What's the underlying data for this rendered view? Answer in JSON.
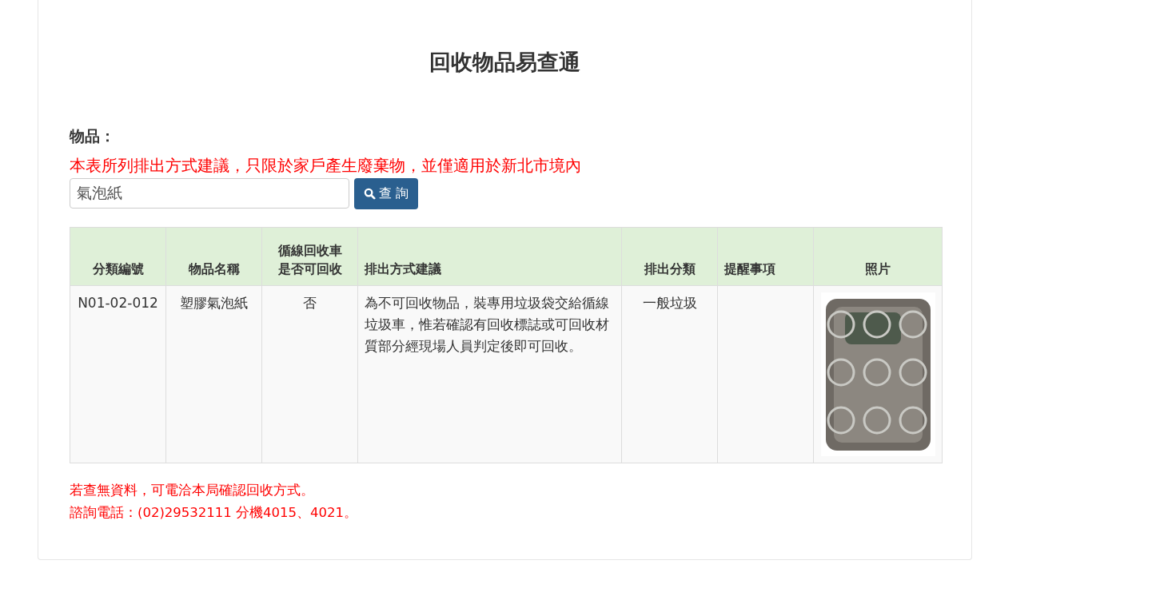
{
  "title": "回收物品易查通",
  "search": {
    "label": "物品：",
    "notice": "本表所列排出方式建議，只限於家戶產生廢棄物，並僅適用於新北市境內",
    "value": "氣泡紙",
    "button": "查 詢"
  },
  "table": {
    "columns": [
      {
        "label": "分類編號"
      },
      {
        "label": "物品名稱"
      },
      {
        "label": "循線回收車是否可回收"
      },
      {
        "label": "排出方式建議"
      },
      {
        "label": "排出分類"
      },
      {
        "label": "提醒事項"
      },
      {
        "label": "照片"
      }
    ],
    "rows": [
      {
        "cells": [
          {
            "kind": "text",
            "text": "N01-02-012"
          },
          {
            "kind": "text",
            "text": "塑膠氣泡紙"
          },
          {
            "kind": "text",
            "text": "否"
          },
          {
            "kind": "text",
            "text": "為不可回收物品，裝專用垃圾袋交給循線垃圾車，惟若確認有回收標誌或可回收材質部分經現場人員判定後即可回收。"
          },
          {
            "kind": "text",
            "text": "一般垃圾"
          },
          {
            "kind": "empty"
          },
          {
            "kind": "picture"
          }
        ]
      }
    ]
  },
  "footer": [
    "若查無資料，可電洽本局確認回收方式。",
    "諮詢電話：(02)29532111 分機4015、4021。"
  ]
}
